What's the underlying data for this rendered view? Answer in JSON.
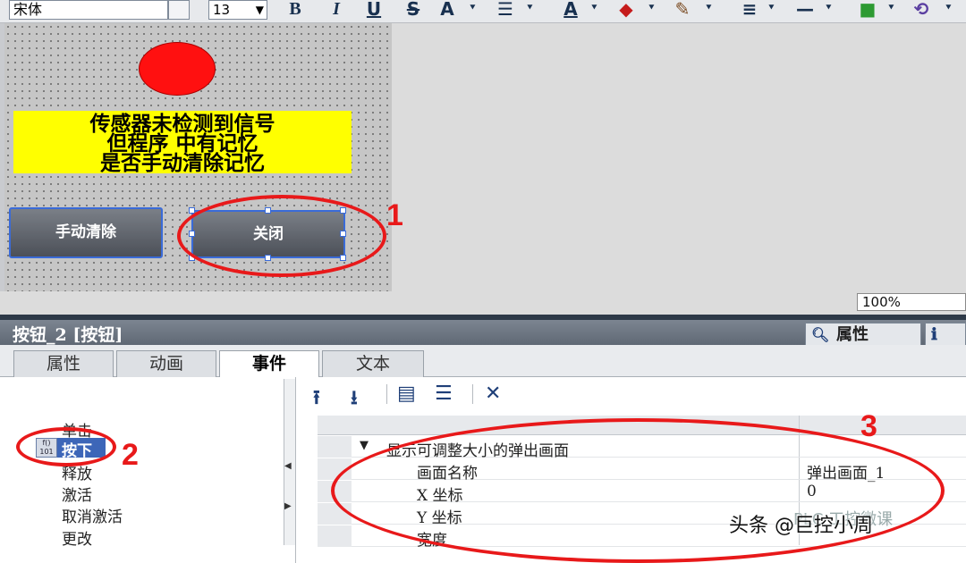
{
  "toolbar": {
    "font_name": "宋体",
    "font_size": "13",
    "bold": "B",
    "italic": "I",
    "underline": "U",
    "strike": "S",
    "superscript": "A",
    "text_color": "A"
  },
  "canvas": {
    "message_lines": [
      "传感器未检测到信号",
      "但程序 中有记忆",
      "是否手动清除记忆"
    ],
    "button_manual_clear": "手动清除",
    "button_close": "关闭",
    "zoom": "100%"
  },
  "inspector": {
    "title": "按钮_2 [按钮]",
    "panel_tab_properties": "属性",
    "tabs": [
      "属性",
      "动画",
      "事件",
      "文本"
    ],
    "active_tab_index": 2,
    "events": [
      "单击",
      "按下",
      "释放",
      "激活",
      "取消激活",
      "更改"
    ],
    "selected_event": "按下",
    "function_row": "显示可调整大小的弹出画面",
    "params": [
      {
        "name": "画面名称",
        "value": "弹出画面_1"
      },
      {
        "name": "X 坐标",
        "value": "0"
      },
      {
        "name": "Y 坐标",
        "value": ""
      },
      {
        "name": "宽度",
        "value": ""
      }
    ]
  },
  "annotations": {
    "one": "1",
    "two": "2",
    "three": "3"
  },
  "watermark": {
    "text": "头条 @巨控小周",
    "ghost": "PLC 工控微课"
  },
  "colors": {
    "annotation": "#e8191a",
    "selection": "#3d66b8",
    "indicator": "#ff1010",
    "message_bg": "#ffff00"
  }
}
